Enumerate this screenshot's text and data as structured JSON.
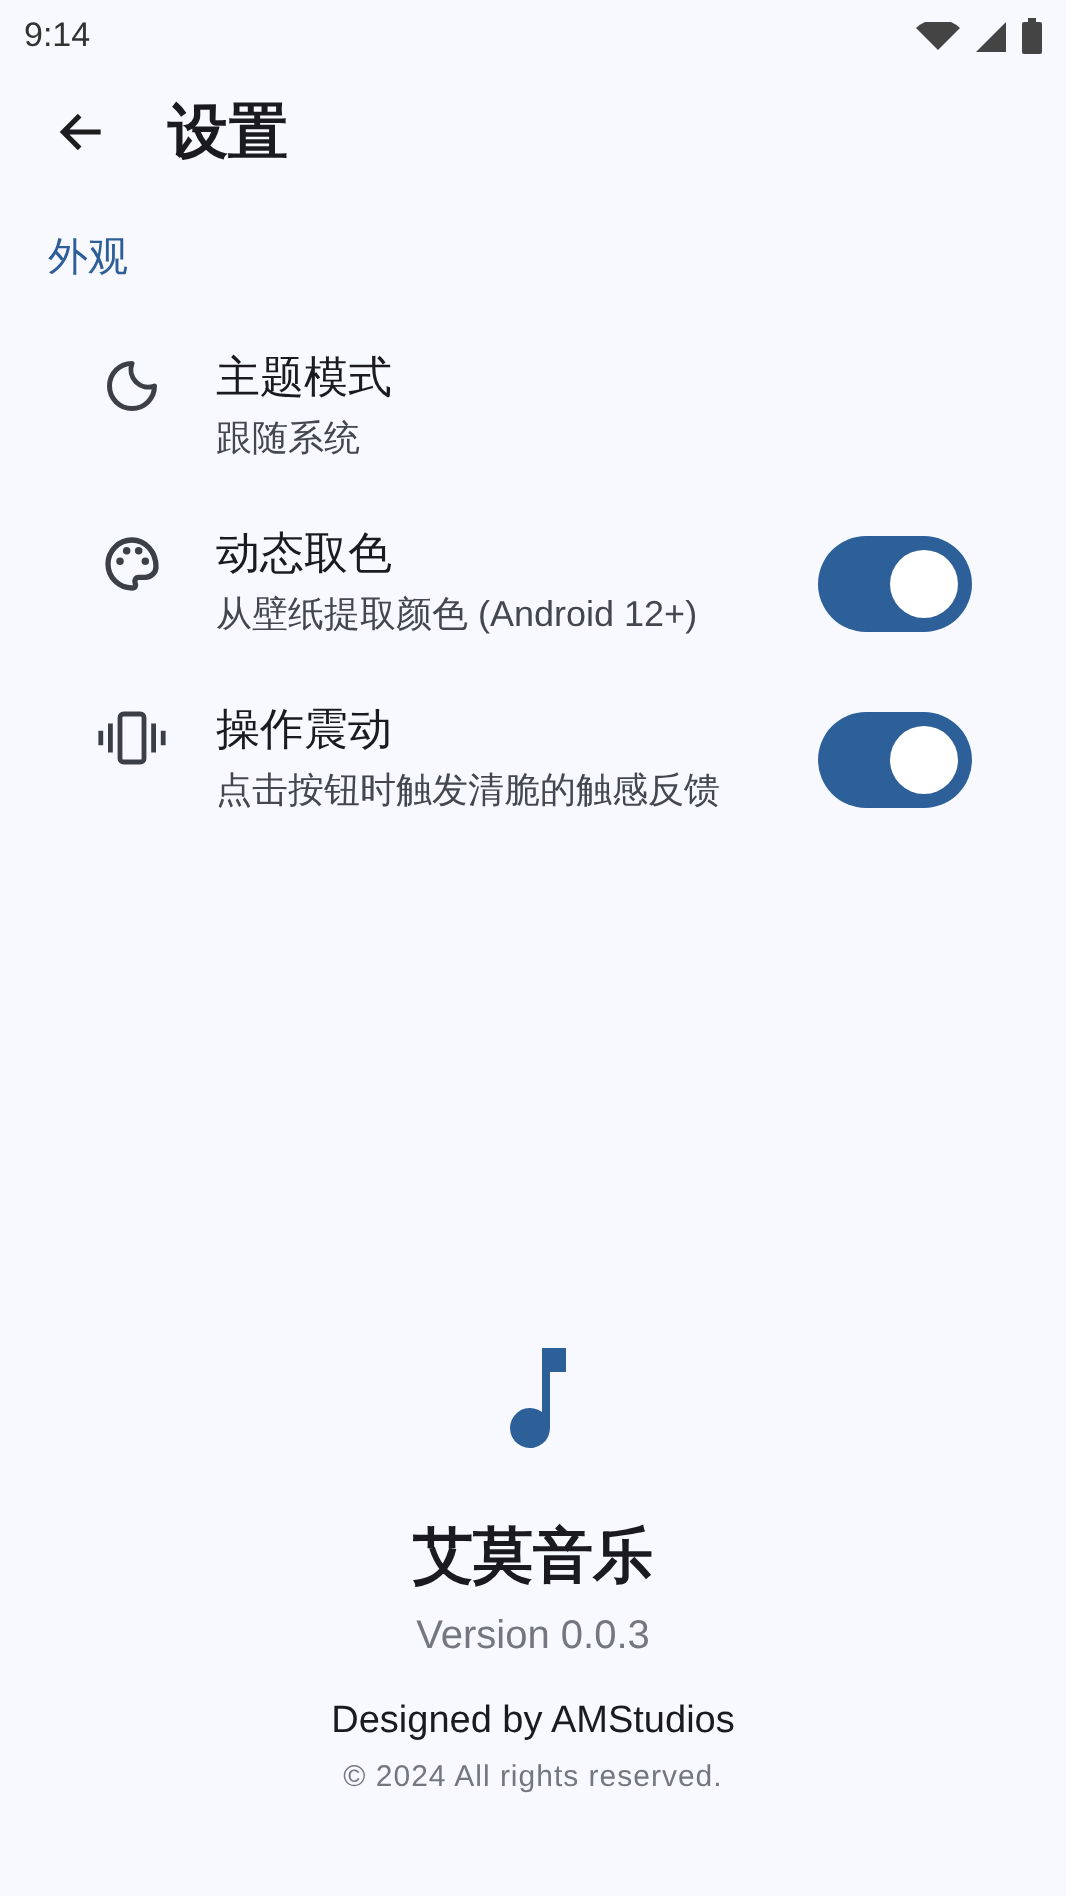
{
  "status_bar": {
    "time": "9:14"
  },
  "header": {
    "title": "设置"
  },
  "section": {
    "title": "外观",
    "items": [
      {
        "kind": "value",
        "title": "主题模式",
        "subtitle": "跟随系统"
      },
      {
        "kind": "switch",
        "title": "动态取色",
        "subtitle": "从壁纸提取颜色 (Android 12+)",
        "on": true
      },
      {
        "kind": "switch",
        "title": "操作震动",
        "subtitle": "点击按钮时触发清脆的触感反馈",
        "on": true
      }
    ]
  },
  "about": {
    "app_name": "艾莫音乐",
    "version": "Version 0.0.3",
    "designer": "Designed by AMStudios",
    "copyright": "© 2024 All rights reserved."
  }
}
